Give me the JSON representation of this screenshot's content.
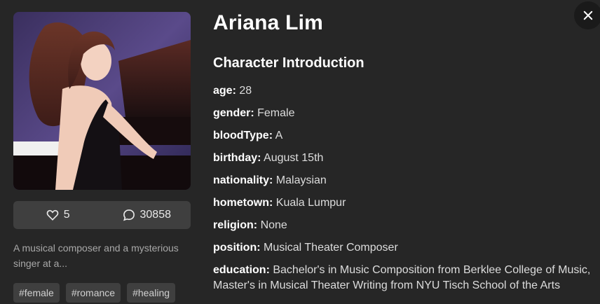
{
  "character": {
    "name": "Ariana Lim",
    "section_title": "Character Introduction",
    "details": [
      {
        "key": "age:",
        "value": "28"
      },
      {
        "key": "gender:",
        "value": "Female"
      },
      {
        "key": "bloodType:",
        "value": "A"
      },
      {
        "key": "birthday:",
        "value": "August 15th"
      },
      {
        "key": "nationality:",
        "value": "Malaysian"
      },
      {
        "key": "hometown:",
        "value": "Kuala Lumpur"
      },
      {
        "key": "religion:",
        "value": "None"
      },
      {
        "key": "position:",
        "value": "Musical Theater Composer"
      },
      {
        "key": "education:",
        "value": "Bachelor's in Music Composition from Berklee College of Music, Master's in Musical Theater Writing from NYU Tisch School of the Arts"
      }
    ]
  },
  "stats": {
    "likes": "5",
    "comments": "30858",
    "like_icon": "heart-icon",
    "comment_icon": "comment-bubble-icon"
  },
  "summary": {
    "blurb": "A musical composer and a mysterious singer at a..."
  },
  "tags": [
    "#female",
    "#romance",
    "#healing"
  ],
  "controls": {
    "close_icon": "close-icon"
  },
  "colors": {
    "background": "#262626",
    "card": "#3f3f3f",
    "muted_text": "#a8a8a8"
  }
}
